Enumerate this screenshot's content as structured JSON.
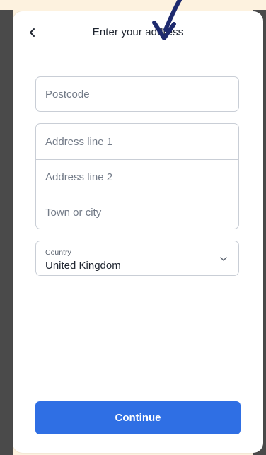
{
  "header": {
    "title": "Enter your address",
    "back_icon": "chevron-left-icon"
  },
  "form": {
    "postcode_placeholder": "Postcode",
    "address_line_1_placeholder": "Address line 1",
    "address_line_2_placeholder": "Address line 2",
    "town_placeholder": "Town or city",
    "country": {
      "label": "Country",
      "selected": "United Kingdom",
      "icon": "chevron-down-icon"
    }
  },
  "actions": {
    "continue_label": "Continue"
  },
  "colors": {
    "accent": "#2f6fe4",
    "annotation_arrow": "#1e2a6e",
    "backdrop": "#fdf2df"
  }
}
